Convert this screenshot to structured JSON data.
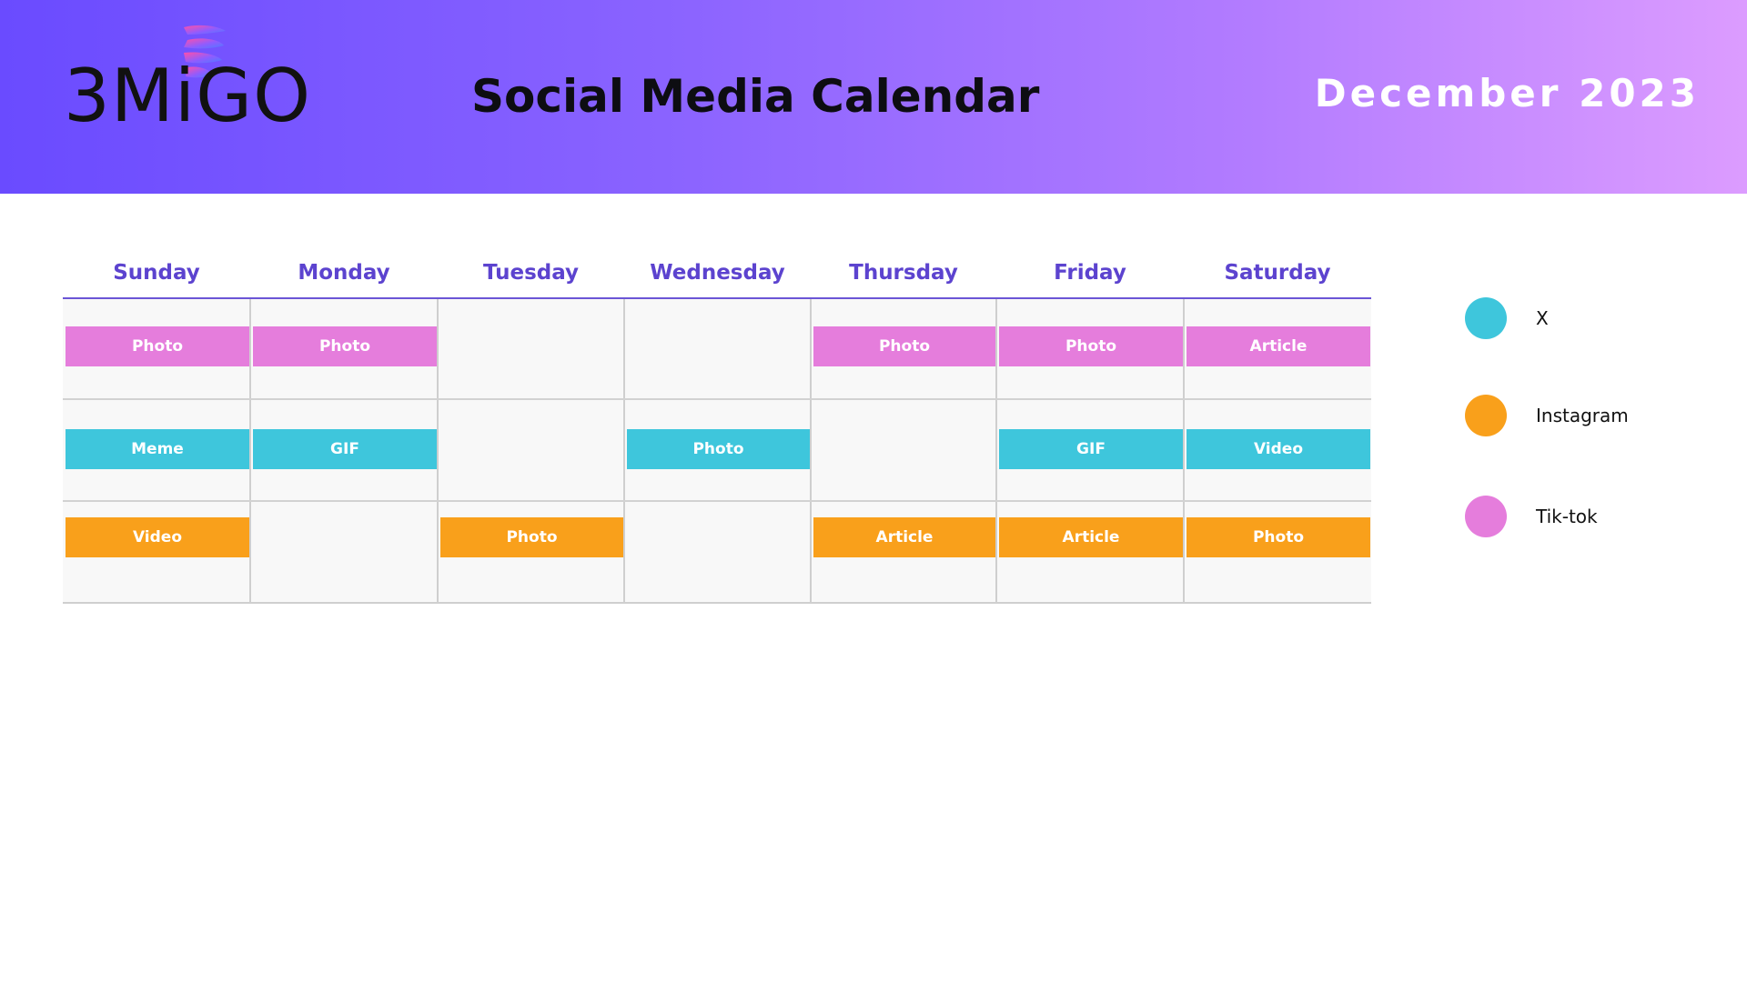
{
  "brand": {
    "name": "3MiGO",
    "logo_icon": "spiral-ribbon-logo"
  },
  "header": {
    "title": "Social Media Calendar",
    "month": "December 2023"
  },
  "colors": {
    "header_gradient": [
      "#6a4bff",
      "#dc9cff"
    ],
    "day_header": "#5c43cf",
    "x": "#3ec6dc",
    "instagram": "#f9a01b",
    "tiktok": "#e57ddc"
  },
  "calendar": {
    "days": [
      "Sunday",
      "Monday",
      "Tuesday",
      "Wednesday",
      "Thursday",
      "Friday",
      "Saturday"
    ],
    "rows": [
      {
        "platform": "tiktok",
        "posts": [
          "Photo",
          "Photo",
          "",
          "",
          "Photo",
          "Photo",
          "Article"
        ]
      },
      {
        "platform": "x",
        "posts": [
          "Meme",
          "GIF",
          "",
          "Photo",
          "",
          "GIF",
          "Video"
        ]
      },
      {
        "platform": "instagram",
        "posts": [
          "Video",
          "",
          "Photo",
          "",
          "Article",
          "Article",
          "Photo"
        ]
      }
    ]
  },
  "legend": [
    {
      "platform": "x",
      "label": "X"
    },
    {
      "platform": "instagram",
      "label": "Instagram"
    },
    {
      "platform": "tiktok",
      "label": "Tik-tok"
    }
  ]
}
